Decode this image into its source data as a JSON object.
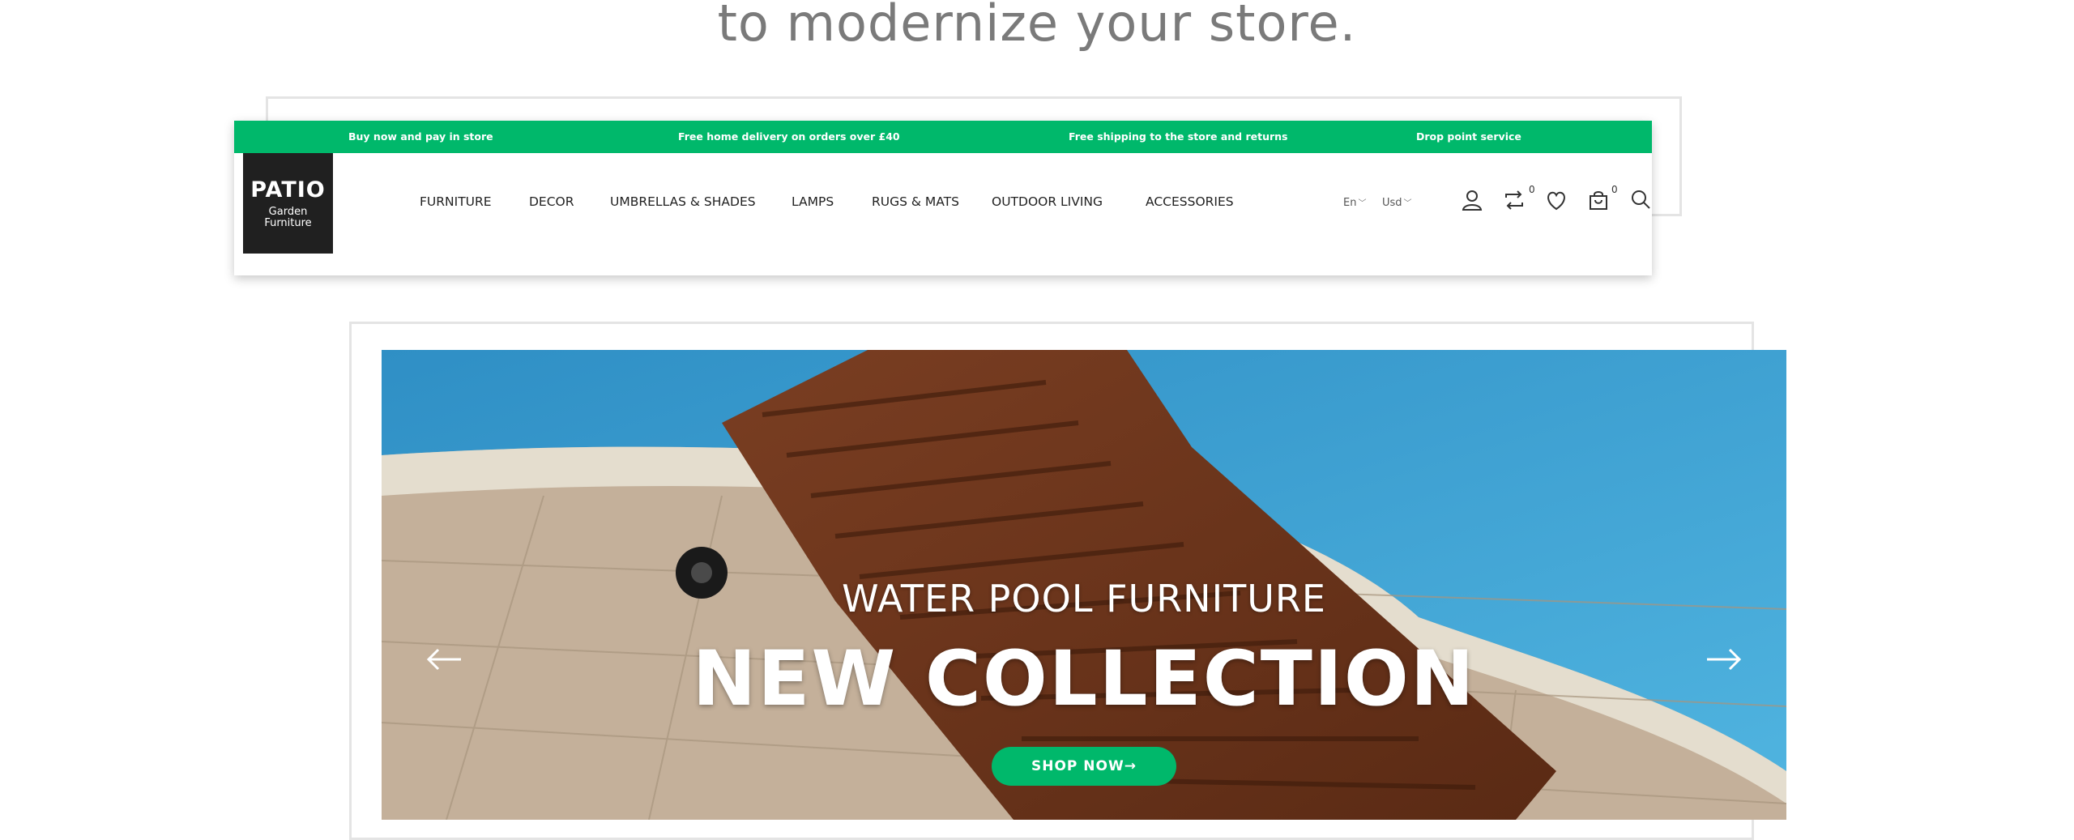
{
  "hero": {
    "tagline": "to modernize your store."
  },
  "topbar": {
    "items": [
      "Buy now and pay in store",
      "Free home delivery on orders over £40",
      "Free shipping to the store and returns",
      "Drop point service"
    ],
    "color": "#00b86b"
  },
  "logo": {
    "brand": "PATIO",
    "line1": "Garden",
    "line2": "Furniture"
  },
  "nav": {
    "items": [
      "FURNITURE",
      "DECOR",
      "UMBRELLAS & SHADES",
      "LAMPS",
      "RUGS & MATS",
      "OUTDOOR LIVING",
      "ACCESSORIES"
    ]
  },
  "selectors": {
    "language": "En",
    "currency": "Usd"
  },
  "icons": {
    "account": "user-icon",
    "compare": "compare-icon",
    "wishlist": "heart-icon",
    "cart": "shopping-bag-icon",
    "search": "search-icon"
  },
  "counters": {
    "compare": "0",
    "cart": "0"
  },
  "slide": {
    "subtitle": "WATER POOL FURNITURE",
    "title": "NEW COLLECTION",
    "button": "SHOP NOW→"
  }
}
